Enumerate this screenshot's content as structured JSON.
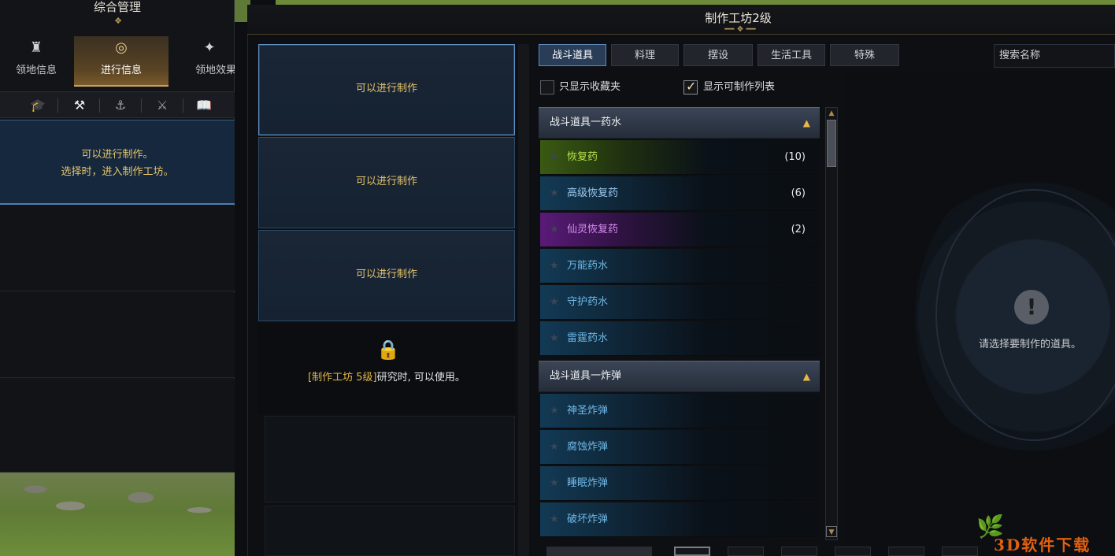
{
  "left_panel": {
    "title": "综合管理",
    "tabs": [
      {
        "icon": "castle-icon",
        "label": "领地信息"
      },
      {
        "icon": "compass-icon",
        "label": "进行信息"
      },
      {
        "icon": "sparkle-icon",
        "label": "领地效果"
      }
    ],
    "icon_row": [
      "graduation-cap-icon",
      "crossed-tools-icon",
      "anchor-icon",
      "crossed-swords-icon",
      "book-icon"
    ],
    "selected_line1": "可以进行制作。",
    "selected_line2": "选择时，进入制作工坊。"
  },
  "workshop": {
    "title": "制作工坊2级",
    "slots": [
      "可以进行制作",
      "可以进行制作",
      "可以进行制作"
    ],
    "locked_highlight": "[制作工坊 5级]",
    "locked_suffix": "研究时, 可以使用。"
  },
  "tabs": [
    "战斗道具",
    "料理",
    "摆设",
    "生活工具",
    "特殊"
  ],
  "active_tab": "战斗道具",
  "search_placeholder": "搜索名称",
  "filters": {
    "favorites_label": "只显示收藏夹",
    "favorites_checked": false,
    "craftable_label": "显示可制作列表",
    "craftable_checked": true
  },
  "categories": [
    {
      "name": "战斗道具一药水",
      "items": [
        {
          "name": "恢复药",
          "count": "(10)",
          "rarity": "green"
        },
        {
          "name": "高级恢复药",
          "count": "(6)",
          "rarity": "blue"
        },
        {
          "name": "仙灵恢复药",
          "count": "(2)",
          "rarity": "purple"
        },
        {
          "name": "万能药水",
          "count": "",
          "rarity": "blue"
        },
        {
          "name": "守护药水",
          "count": "",
          "rarity": "blue"
        },
        {
          "name": "雷霆药水",
          "count": "",
          "rarity": "blue"
        }
      ]
    },
    {
      "name": "战斗道具一炸弹",
      "items": [
        {
          "name": "神圣炸弹",
          "count": "",
          "rarity": "blue"
        },
        {
          "name": "腐蚀炸弹",
          "count": "",
          "rarity": "blue"
        },
        {
          "name": "睡眠炸弹",
          "count": "",
          "rarity": "blue"
        },
        {
          "name": "破坏炸弹",
          "count": "",
          "rarity": "blue"
        }
      ]
    }
  ],
  "detail": {
    "empty_message": "请选择要制作的道具。"
  },
  "watermark": "3D软件下载",
  "colors": {
    "gold": "#e6c56a",
    "accent_blue": "#5e87b8",
    "item_blue": "#6fb8e6",
    "item_green": "#b7e04a",
    "item_purple": "#d68ef0"
  }
}
